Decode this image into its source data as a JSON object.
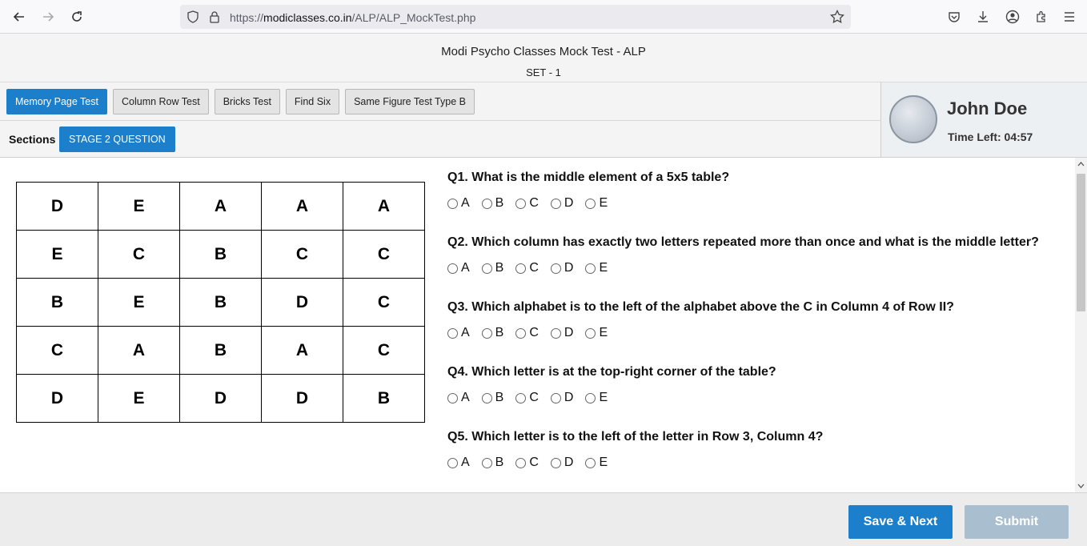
{
  "browser": {
    "url_prefix": "https://",
    "url_host": "modiclasses.co.in",
    "url_path": "/ALP/ALP_MockTest.php"
  },
  "header": {
    "title": "Modi Psycho Classes Mock Test - ALP",
    "set": "SET - 1"
  },
  "tabs": [
    {
      "label": "Memory Page Test",
      "active": true
    },
    {
      "label": "Column Row Test",
      "active": false
    },
    {
      "label": "Bricks Test",
      "active": false
    },
    {
      "label": "Find Six",
      "active": false
    },
    {
      "label": "Same Figure Test Type B",
      "active": false
    }
  ],
  "sections": {
    "label": "Sections",
    "stage_button": "STAGE 2 QUESTION"
  },
  "user": {
    "name": "John Doe",
    "time_left": "Time Left: 04:57"
  },
  "table": [
    [
      "D",
      "E",
      "A",
      "A",
      "A"
    ],
    [
      "E",
      "C",
      "B",
      "C",
      "C"
    ],
    [
      "B",
      "E",
      "B",
      "D",
      "C"
    ],
    [
      "C",
      "A",
      "B",
      "A",
      "C"
    ],
    [
      "D",
      "E",
      "D",
      "D",
      "B"
    ]
  ],
  "questions": [
    {
      "text": "Q1. What is the middle element of a 5x5 table?",
      "options": [
        "A",
        "B",
        "C",
        "D",
        "E"
      ]
    },
    {
      "text": "Q2. Which column has exactly two letters repeated more than once and what is the middle letter?",
      "options": [
        "A",
        "B",
        "C",
        "D",
        "E"
      ]
    },
    {
      "text": "Q3. Which alphabet is to the left of the alphabet above the C in Column 4 of Row II?",
      "options": [
        "A",
        "B",
        "C",
        "D",
        "E"
      ]
    },
    {
      "text": "Q4. Which letter is at the top-right corner of the table?",
      "options": [
        "A",
        "B",
        "C",
        "D",
        "E"
      ]
    },
    {
      "text": "Q5. Which letter is to the left of the letter in Row 3, Column 4?",
      "options": [
        "A",
        "B",
        "C",
        "D",
        "E"
      ]
    }
  ],
  "footer": {
    "save_next": "Save & Next",
    "submit": "Submit"
  }
}
